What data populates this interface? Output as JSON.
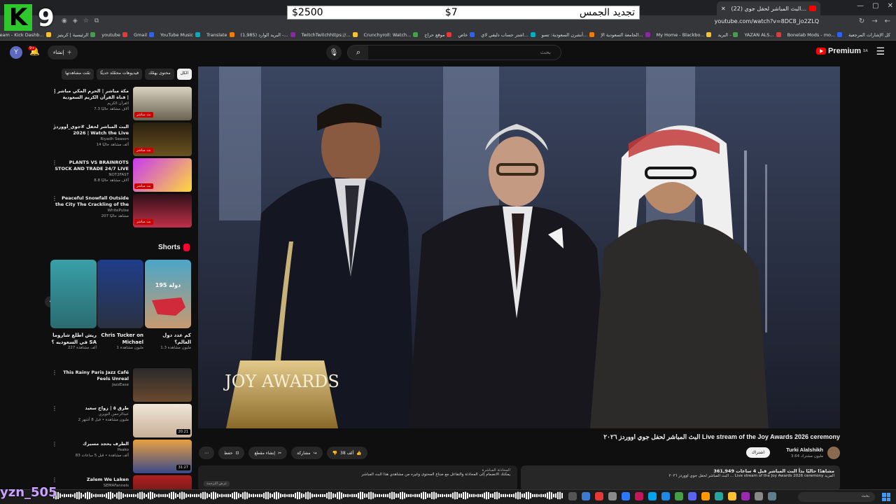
{
  "overlay": {
    "logo_letter": "K",
    "logo_number": "9",
    "username": "yzn_505"
  },
  "goal_bar": {
    "right_value": "$2500",
    "middle_value": "$7",
    "left_label": "تجديد الجمس"
  },
  "browser": {
    "tab_title": "(22) البث المباشر لحفل جوي...",
    "url": "youtube.com/watch?v=8DC8_jo2ZLQ",
    "bookmarks": [
      "Bonelab Mods - mo...",
      "YAZAN ALS...",
      "البريد -",
      "My Home - Blackbo...",
      "الجامعة السعودية الإ...",
      "أنشرن السعودية: تسو...",
      "اشتر حساب دليفي لاي...",
      "خاص",
      "موقع حراج",
      "Crunchyroll: Watch...",
      "TwitchTwitchhttps://...",
      "(1,985) البريد الوارد -...",
      "Translate",
      "YouTube Music",
      "Gmail",
      "youtube",
      "الرئيسية | كريتيز",
      "Stream - Kick Dashb...",
      "Kick",
      "Google"
    ],
    "all_bookmarks": "كل الإشارات المرجعية"
  },
  "header": {
    "logo_text": "Premium",
    "logo_region": "SA",
    "search_placeholder": "بحث",
    "create_label": "إنشاء",
    "notif_count": "9+",
    "avatar_letter": "Y"
  },
  "filters": [
    "الكل",
    "محتوى يهمّك",
    "فيديوهات محمّلة حديثًا",
    "تمّت مشاهدتها"
  ],
  "recommended": [
    {
      "title": "مكة مباشر | الحرم المكي مباشر | قناة القرآن الكريم السعودية | Makkah Live",
      "channel": "القرآن الكريم",
      "views": "7.3 آلاف مشاهد حاليًا",
      "tag": "بث مباشر"
    },
    {
      "title": "البث المباشر لحفل #جوي_أووردز 2026 | Watch the Live Stream of the Joy",
      "channel": "Riyadh Season",
      "views": "14 ألف مشاهد حاليًا",
      "tag": "بث مباشر"
    },
    {
      "title": "PLANTS VS BRAINROTS STOCK AND TRADE 24/7 LIVE",
      "channel": "NOT2FAST",
      "views": "8.8 آلاف مشاهد حاليًا",
      "tag": "بث مباشر"
    },
    {
      "title": "Peaceful Snowfall Outside the City The Crackling of the",
      "channel": "WhitePulse",
      "views": "207 مشاهد حاليًا",
      "tag": "بث مباشر"
    }
  ],
  "shorts": {
    "heading": "Shorts",
    "items": [
      {
        "title": "كم عدد دول العالم؟",
        "views": "1.3 مليون مشاهدة",
        "badge": "195 دولة"
      },
      {
        "title": "Chris Tucker on Michael",
        "views": "1 مليون مشاهدة",
        "badge": ""
      },
      {
        "title": "ريش اطلع شاروما في السعوديه ؟ SA",
        "views": "227 ألف مشاهدة",
        "badge": ""
      }
    ]
  },
  "more_recommended": [
    {
      "title": "This Rainy Paris Jazz Café Feels Unreal",
      "channel": "JazzEase",
      "views": "",
      "duration": ""
    },
    {
      "title": "طرق ٥ | زواج سعيد",
      "channel": "عبدالرحمن التويزي",
      "views": "2 مليون مشاهدة • قبل 8 أشهر",
      "duration": "20:21"
    },
    {
      "title": "الطرف يحجد مسيرك",
      "channel": "Peako",
      "views": "83 ألف مشاهدة • قبل 5 ساعات",
      "duration": "31:27"
    },
    {
      "title": "Zalem We Laken",
      "channel": "SEMAFannels",
      "views": "",
      "duration": ""
    }
  ],
  "video": {
    "title": "البث المباشر لحفل جوي اووردز ٢٠٢٦ Live stream of the Joy Awards 2026 ceremony",
    "stage_sign": "JOY AWARDS",
    "channel": "Turki Alalshikh",
    "subscribers": "3.64 مليون مشترك",
    "subscribe_label": "اشتراك",
    "likes": "38 ألف",
    "share_label": "مشاركة",
    "clip_label": "إنشاء مقطع",
    "save_label": "حفظ",
    "views_line": "361,949 مشاهدًا حاليًا  بدأ البث المباشر قبل 4 ساعات",
    "desc_line": "البث المباشر لحفل جوي اووردز ٢٠٢٦ ... Live stream of the Joy Awards 2026 ceremony المزيد",
    "chat_title": "المحادثة المباشرة",
    "chat_note": "يمكنك الانضمام إلى المحادثة والتفاعل مع صناع المحتوى وغيره من مشاهدي هذا البث المباشر",
    "chat_button": "عرض الترجمة"
  },
  "taskbar": {
    "search_placeholder": "بحث"
  },
  "colors": {
    "accent": "#ff0000",
    "background": "#0f0f0f",
    "kick_green": "#2ec82e"
  }
}
